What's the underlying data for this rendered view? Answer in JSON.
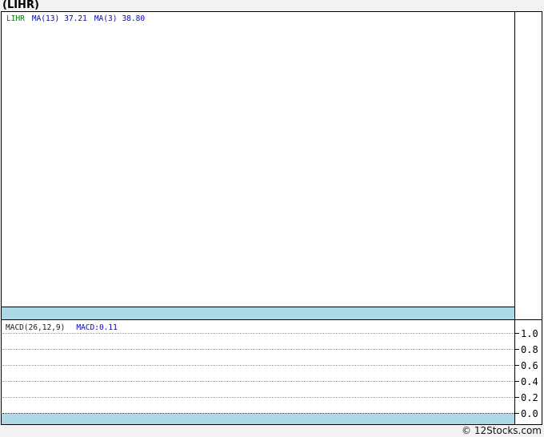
{
  "page": {
    "title": "(LIHR)"
  },
  "main_chart": {
    "legend": {
      "symbol": "LIHR",
      "ma13_label": "MA(13)",
      "ma13_value": "37.21",
      "ma3_label": "MA(3)",
      "ma3_value": "38.80"
    }
  },
  "macd_panel": {
    "indicator_label": "MACD(26,12,9)",
    "indicator_value": "MACD:0.11",
    "axis_ticks": [
      "1.0",
      "0.8",
      "0.6",
      "0.4",
      "0.2",
      "0.0"
    ]
  },
  "footer": {
    "copyright": "© 12Stocks.com"
  },
  "colors": {
    "band_lightblue": "#ADD8E6",
    "symbol_green": "#008000",
    "indicator_blue": "#0000CC",
    "border_black": "#000000",
    "page_background": "#F2F2F2",
    "gridline_gray": "#999999"
  },
  "chart_data": [
    {
      "type": "line",
      "title": "(LIHR) price with moving averages",
      "series": [
        {
          "name": "LIHR",
          "values": []
        },
        {
          "name": "MA(13)",
          "current_value": 37.21,
          "values": []
        },
        {
          "name": "MA(3)",
          "current_value": 38.8,
          "values": []
        }
      ],
      "legend_position": "top-left",
      "grid": false,
      "note": "main plot area is blank - no visible price curve; solid lightblue band along bottom of panel"
    },
    {
      "type": "line",
      "title": "MACD(26,12,9)",
      "series": [
        {
          "name": "MACD",
          "current_value": 0.11,
          "values": []
        }
      ],
      "ylim": [
        -0.15,
        1.15
      ],
      "yticks": [
        1.0,
        0.8,
        0.6,
        0.4,
        0.2,
        0.0
      ],
      "grid": "horizontal dotted, zero line darker dotted",
      "legend_position": "top-left",
      "note": "no visible MACD curve plotted; solid lightblue band along bottom of panel"
    }
  ]
}
